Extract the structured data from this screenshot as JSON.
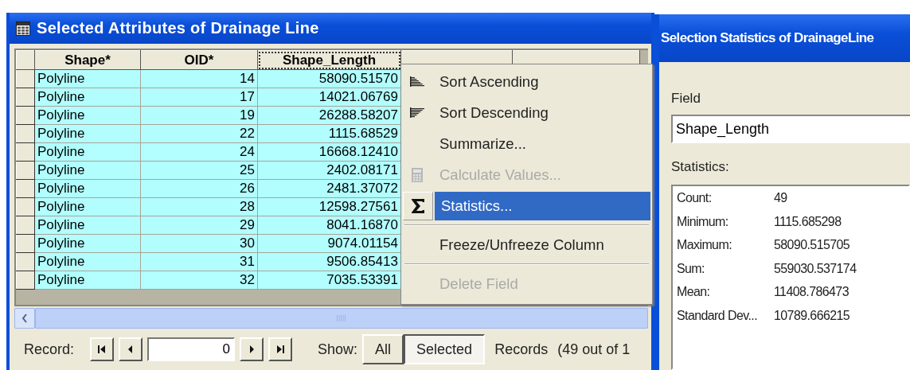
{
  "table_window": {
    "title": "Selected Attributes of Drainage Line",
    "columns": [
      {
        "label": "Shape*",
        "selected": false
      },
      {
        "label": "OID*",
        "selected": false
      },
      {
        "label": "Shape_Length",
        "selected": true
      }
    ],
    "rows": [
      {
        "shape": "Polyline",
        "oid": "14",
        "shape_length": "58090.51570"
      },
      {
        "shape": "Polyline",
        "oid": "17",
        "shape_length": "14021.06769"
      },
      {
        "shape": "Polyline",
        "oid": "19",
        "shape_length": "26288.58207"
      },
      {
        "shape": "Polyline",
        "oid": "22",
        "shape_length": "1115.68529"
      },
      {
        "shape": "Polyline",
        "oid": "24",
        "shape_length": "16668.12410"
      },
      {
        "shape": "Polyline",
        "oid": "25",
        "shape_length": "2402.08171"
      },
      {
        "shape": "Polyline",
        "oid": "26",
        "shape_length": "2481.37072"
      },
      {
        "shape": "Polyline",
        "oid": "28",
        "shape_length": "12598.27561"
      },
      {
        "shape": "Polyline",
        "oid": "29",
        "shape_length": "8041.16870"
      },
      {
        "shape": "Polyline",
        "oid": "30",
        "shape_length": "9074.01154"
      },
      {
        "shape": "Polyline",
        "oid": "31",
        "shape_length": "9506.85413"
      },
      {
        "shape": "Polyline",
        "oid": "32",
        "shape_length": "7035.53391"
      }
    ],
    "context_menu": [
      {
        "kind": "ascending",
        "label": "Sort Ascending",
        "disabled": false,
        "selected": false
      },
      {
        "kind": "descending",
        "label": "Sort Descending",
        "disabled": false,
        "selected": false
      },
      {
        "kind": "plain",
        "label": "Summarize...",
        "disabled": false,
        "selected": false
      },
      {
        "kind": "calculator",
        "label": "Calculate Values...",
        "disabled": true,
        "selected": false
      },
      {
        "kind": "sigma",
        "label": "Statistics...",
        "disabled": false,
        "selected": true
      },
      {
        "kind": "separator"
      },
      {
        "kind": "plain",
        "label": "Freeze/Unfreeze Column",
        "disabled": false,
        "selected": false
      },
      {
        "kind": "separator"
      },
      {
        "kind": "plain",
        "label": "Delete Field",
        "disabled": true,
        "selected": false
      }
    ],
    "record_bar": {
      "label": "Record:",
      "value": "0",
      "show_label": "Show:",
      "show_options": [
        {
          "label": "All",
          "selected": false
        },
        {
          "label": "Selected",
          "selected": true
        }
      ],
      "records_label": "Records",
      "count": "(49 out of 1"
    }
  },
  "stats_window": {
    "title": "Selection Statistics of DrainageLine",
    "field_label": "Field",
    "field_value": "Shape_Length",
    "statistics_label": "Statistics:",
    "statistics": [
      {
        "name": "Count:",
        "value": "49"
      },
      {
        "name": "Minimum:",
        "value": "1115.685298"
      },
      {
        "name": "Maximum:",
        "value": "58090.515705"
      },
      {
        "name": "Sum:",
        "value": "559030.537174"
      },
      {
        "name": "Mean:",
        "value": "11408.786473"
      },
      {
        "name": "Standard Dev...",
        "value": "10789.666215"
      }
    ]
  }
}
